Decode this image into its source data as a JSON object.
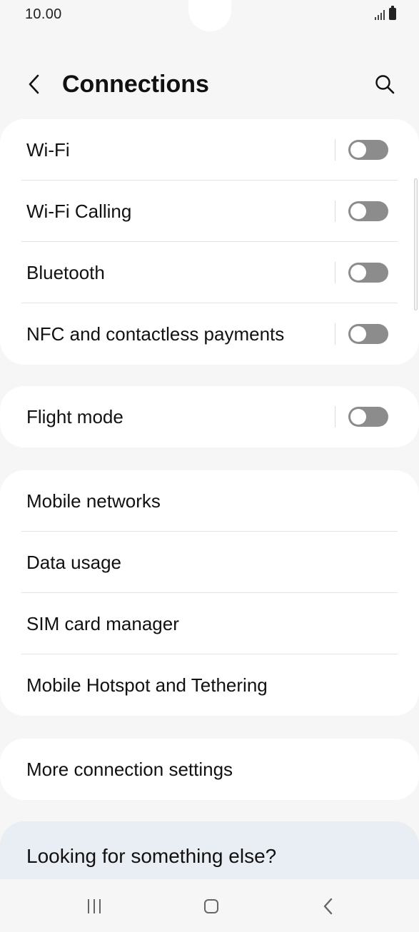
{
  "status_bar": {
    "time": "10.00"
  },
  "header": {
    "title": "Connections"
  },
  "groups": [
    {
      "items": [
        {
          "label": "Wi-Fi",
          "toggle": "off"
        },
        {
          "label": "Wi-Fi Calling",
          "toggle": "off"
        },
        {
          "label": "Bluetooth",
          "toggle": "off"
        },
        {
          "label": "NFC and contactless payments",
          "toggle": "off"
        }
      ]
    },
    {
      "items": [
        {
          "label": "Flight mode",
          "toggle": "off"
        }
      ]
    },
    {
      "items": [
        {
          "label": "Mobile networks"
        },
        {
          "label": "Data usage"
        },
        {
          "label": "SIM card manager"
        },
        {
          "label": "Mobile Hotspot and Tethering"
        }
      ]
    },
    {
      "items": [
        {
          "label": "More connection settings"
        }
      ]
    }
  ],
  "suggestion": {
    "label": "Looking for something else?"
  },
  "icons": {
    "back": "chevron-left-icon",
    "search": "search-icon",
    "nav_recents": "recents-icon",
    "nav_home": "home-icon",
    "nav_back": "back-icon"
  },
  "colors": {
    "background": "#f6f6f6",
    "card": "#ffffff",
    "toggle_off": "#8c8c8c",
    "suggestion_bg": "#e9edf4"
  }
}
